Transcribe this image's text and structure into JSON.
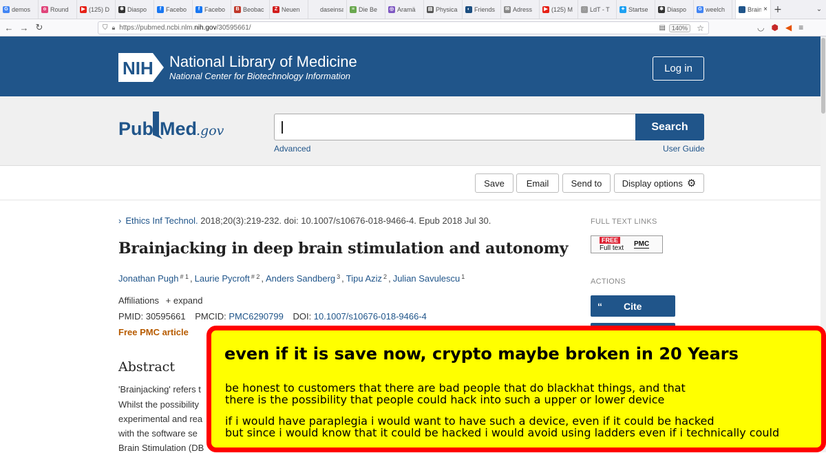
{
  "browser": {
    "tabs": [
      {
        "label": "demos",
        "icon": "google-icon",
        "color": "#4285f4",
        "glyph": "G"
      },
      {
        "label": "Round",
        "icon": "round-icon",
        "color": "#e0457b",
        "glyph": "o"
      },
      {
        "label": "(125) D",
        "icon": "youtube-icon",
        "color": "#e62117",
        "glyph": "▶"
      },
      {
        "label": "Diaspo",
        "icon": "diaspora-icon",
        "color": "#333333",
        "glyph": "✱"
      },
      {
        "label": "Facebo",
        "icon": "facebook-icon",
        "color": "#1877f2",
        "glyph": "f"
      },
      {
        "label": "Facebo",
        "icon": "facebook-icon",
        "color": "#1877f2",
        "glyph": "f"
      },
      {
        "label": "Beobac",
        "icon": "news-icon",
        "color": "#c0392b",
        "glyph": "B"
      },
      {
        "label": "Neuen",
        "icon": "zeit-icon",
        "color": "#d21e1e",
        "glyph": "Z"
      },
      {
        "label": "daseinsan",
        "icon": "blank-icon",
        "color": "#f0f0f4",
        "glyph": ""
      },
      {
        "label": "Die Be",
        "icon": "page-icon",
        "color": "#6aa84f",
        "glyph": "≡"
      },
      {
        "label": "Aramä",
        "icon": "globe-icon",
        "color": "#7e57c2",
        "glyph": "◎"
      },
      {
        "label": "Physica",
        "icon": "doc-icon",
        "color": "#555555",
        "glyph": "▤"
      },
      {
        "label": "Friends",
        "icon": "friendica-icon",
        "color": "#1c4e80",
        "glyph": "◐"
      },
      {
        "label": "Adress",
        "icon": "mail-icon",
        "color": "#888888",
        "glyph": "✉"
      },
      {
        "label": "(125) M",
        "icon": "youtube-icon",
        "color": "#e62117",
        "glyph": "▶"
      },
      {
        "label": "LdT - T",
        "icon": "globe-icon",
        "color": "#999999",
        "glyph": "◌"
      },
      {
        "label": "Startse",
        "icon": "twitter-icon",
        "color": "#1da1f2",
        "glyph": "✦"
      },
      {
        "label": "Diaspo",
        "icon": "diaspora-icon",
        "color": "#333333",
        "glyph": "✱"
      },
      {
        "label": "weelch",
        "icon": "google-icon",
        "color": "#4285f4",
        "glyph": "G"
      }
    ],
    "active_tab": {
      "label": "Brain",
      "close": "×"
    },
    "new_tab": "+",
    "tab_menu": "⌄",
    "url_prefix": "https://pubmed.ncbi.nlm.",
    "url_host": "nih.gov",
    "url_path": "/30595661/",
    "zoom": "140%"
  },
  "nlm": {
    "logo_text": "NIH",
    "title": "National Library of Medicine",
    "subtitle": "National Center for Biotechnology Information",
    "login": "Log in"
  },
  "search": {
    "logo_pub": "Pub",
    "logo_med": "Med",
    "logo_gov": ".gov",
    "button": "Search",
    "advanced": "Advanced",
    "user_guide": "User Guide"
  },
  "actions": {
    "save": "Save",
    "email": "Email",
    "send_to": "Send to",
    "display_options": "Display options"
  },
  "article": {
    "chevron": "›",
    "journal": "Ethics Inf Technol.",
    "citation": " 2018;20(3):219-232. doi: 10.1007/s10676-018-9466-4. Epub 2018 Jul 30.",
    "title": "Brainjacking in deep brain stimulation and autonomy",
    "authors": [
      {
        "name": "Jonathan Pugh",
        "sup": "# 1",
        "sep": ","
      },
      {
        "name": "Laurie Pycroft",
        "sup": "# 2",
        "sep": ","
      },
      {
        "name": "Anders Sandberg",
        "sup": "3",
        "sep": ","
      },
      {
        "name": "Tipu Aziz",
        "sup": "2",
        "sep": ","
      },
      {
        "name": "Julian Savulescu",
        "sup": "1",
        "sep": ""
      }
    ],
    "affiliations_label": "Affiliations",
    "expand": "+ expand",
    "pmid_label": "PMID: 30595661",
    "pmcid_label": "PMCID: ",
    "pmcid": "PMC6290799",
    "doi_label": "DOI: ",
    "doi": "10.1007/s10676-018-9466-4",
    "free_pmc": "Free PMC article",
    "abstract_heading": "Abstract",
    "abstract_lines": [
      "'Brainjacking' refers t",
      "Whilst the possibility",
      "experimental and rea",
      "with the software se",
      "Brain Stimulation (DB"
    ]
  },
  "sidebar": {
    "full_text_heading": "FULL TEXT LINKS",
    "badge_free": "FREE",
    "badge_fulltext": "Full text",
    "badge_pmc": "PMC",
    "actions_heading": "ACTIONS",
    "cite_icon": "“",
    "cite": "Cite"
  },
  "note": {
    "headline": "even if it is save now, crypto maybe broken in 20 Years",
    "lines": [
      "be honest to customers that there are bad people that do blackhat things, and that",
      "there is the possibility that people could hack into such a upper or lower device",
      "if i would have paraplegia i would want to have such a device, even if it could be hacked",
      "but since i would know that it could be hacked i would avoid using ladders even if i technically could"
    ]
  }
}
